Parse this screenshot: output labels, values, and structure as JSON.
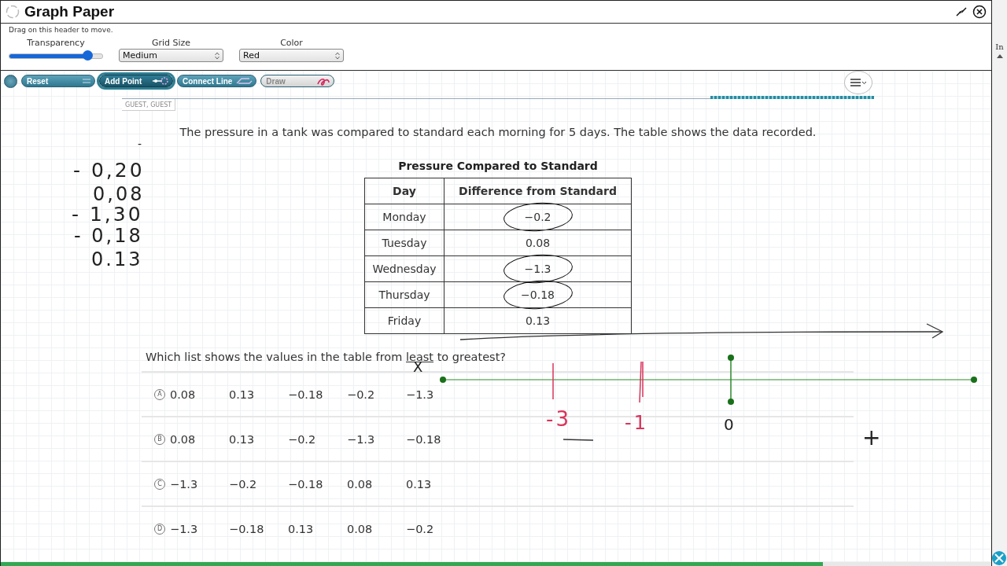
{
  "window": {
    "title": "Graph Paper",
    "hint": "Drag on this header to move."
  },
  "settings": {
    "transparency": {
      "label": "Transparency",
      "level": 0.85
    },
    "grid_size": {
      "label": "Grid Size",
      "value": "Medium"
    },
    "color": {
      "label": "Color",
      "value": "Red"
    }
  },
  "toolbar": [
    {
      "label": "Reset",
      "kind": "reset",
      "selected": false,
      "disabled": false
    },
    {
      "label": "Add Point",
      "kind": "point",
      "selected": true,
      "disabled": false
    },
    {
      "label": "Connect Line",
      "kind": "line",
      "selected": false,
      "disabled": false
    },
    {
      "label": "Draw",
      "kind": "draw",
      "selected": false,
      "disabled": true
    }
  ],
  "user_tab": "GUEST, GUEST",
  "question": "The pressure in a tank was compared to standard each morning for 5 days. The table shows the data recorded.",
  "table": {
    "title": "Pressure Compared to Standard",
    "columns": [
      "Day",
      "Difference from Standard"
    ],
    "rows": [
      {
        "day": "Monday",
        "difference": "−0.2",
        "circled": true
      },
      {
        "day": "Tuesday",
        "difference": "0.08",
        "circled": false
      },
      {
        "day": "Wednesday",
        "difference": "−1.3",
        "circled": true
      },
      {
        "day": "Thursday",
        "difference": "−0.18",
        "circled": true
      },
      {
        "day": "Friday",
        "difference": "0.13",
        "circled": false
      }
    ]
  },
  "prompt": {
    "before": "Which list shows the values in the table from ",
    "underlined": "least",
    "after": " to greatest?"
  },
  "choices": [
    {
      "letter": "A",
      "values": [
        "0.08",
        "0.13",
        "−0.18",
        "−0.2",
        "−1.3"
      ]
    },
    {
      "letter": "B",
      "values": [
        "0.08",
        "0.13",
        "−0.2",
        "−1.3",
        "−0.18"
      ]
    },
    {
      "letter": "C",
      "values": [
        "−1.3",
        "−0.2",
        "−0.18",
        "0.08",
        "0.13"
      ]
    },
    {
      "letter": "D",
      "values": [
        "−1.3",
        "−0.18",
        "0.13",
        "0.08",
        "−0.2"
      ]
    }
  ],
  "handwriting": [
    {
      "text": "-",
      "color": "#222222"
    },
    {
      "text": "- 0,20",
      "color": "#222222"
    },
    {
      "text": "0,08",
      "color": "#222222"
    },
    {
      "text": "- 1,30",
      "color": "#222222"
    },
    {
      "text": "- 0,18",
      "color": "#222222"
    },
    {
      "text": "0.13",
      "color": "#222222"
    },
    {
      "text": "X",
      "color": "#222222"
    },
    {
      "text": "-3",
      "color": "#d9345a"
    },
    {
      "text": "-1",
      "color": "#d9345a"
    },
    {
      "text": "0",
      "color": "#222222"
    },
    {
      "text": "+",
      "color": "#222222"
    }
  ],
  "progress": {
    "level": 0.83
  },
  "side_strip": "In"
}
